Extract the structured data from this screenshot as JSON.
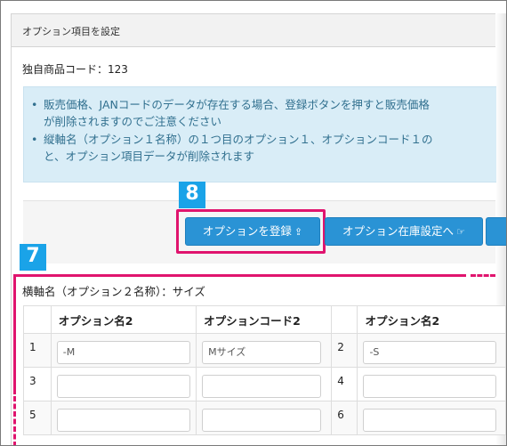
{
  "panel": {
    "title": "オプション項目を設定"
  },
  "product": {
    "code_label": "独自商品コード：123"
  },
  "info": {
    "items": [
      {
        "line1": "販売価格、JANコードのデータが存在する場合、登録ボタンを押すと販売価格",
        "line2": "が削除されますのでご注意ください"
      },
      {
        "line1": "縦軸名（オプション１名称）の１つ目のオプション１、オプションコード１の",
        "line2": "と、オプション項目データが削除されます"
      }
    ]
  },
  "buttons": {
    "register": "オプションを登録",
    "stock": "オプション在庫設定へ"
  },
  "badges": {
    "b8": "8",
    "b7": "7"
  },
  "axis": {
    "horizontal_label": "横軸名（オプション２名称）：サイズ"
  },
  "table": {
    "headers": [
      "オプション名2",
      "オプションコード2",
      "オプション名2"
    ],
    "rows": [
      {
        "num_left": "1",
        "name": "-M",
        "code": "Mサイズ",
        "num_right": "2",
        "name_right": "-S"
      },
      {
        "num_left": "3",
        "name": "",
        "code": "",
        "num_right": "4",
        "name_right": ""
      },
      {
        "num_left": "5",
        "name": "",
        "code": "",
        "num_right": "6",
        "name_right": ""
      }
    ]
  },
  "colors": {
    "primary_button": "#2a93d5",
    "highlight": "#e0146e",
    "badge": "#1aa3e8",
    "info_bg": "#d9edf7"
  }
}
